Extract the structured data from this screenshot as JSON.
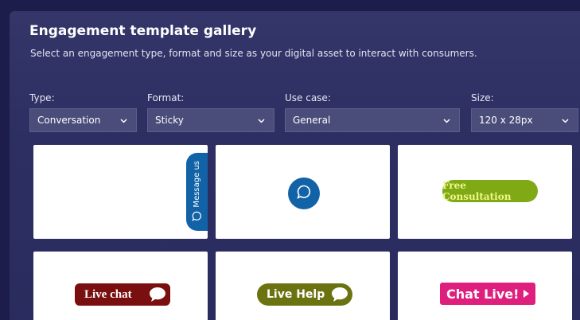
{
  "header": {
    "title": "Engagement template gallery",
    "subtitle": "Select an engagement type, format and size as your digital asset to interact with consumers."
  },
  "filters": {
    "type": {
      "label": "Type:",
      "value": "Conversation"
    },
    "format": {
      "label": "Format:",
      "value": "Sticky"
    },
    "use_case": {
      "label": "Use case:",
      "value": "General"
    },
    "size": {
      "label": "Size:",
      "value": "120 x 28px"
    }
  },
  "templates": [
    {
      "label": "Message us",
      "style": "vertical-side-tab",
      "color": "#1262a8",
      "icon": "chat-bubble-icon"
    },
    {
      "label": "",
      "style": "circle-icon-button",
      "color": "#1262a8",
      "icon": "chat-bubble-icon"
    },
    {
      "label": "Free Consultation",
      "style": "pill",
      "color": "#7faa16"
    },
    {
      "label": "Live chat",
      "style": "rounded",
      "color": "#7a0f0f",
      "icon": "speech-bubble-icon"
    },
    {
      "label": "Live Help",
      "style": "pill",
      "color": "#6b7310",
      "icon": "speech-bubble-icon"
    },
    {
      "label": "Chat Live!",
      "style": "rect",
      "color": "#df1f7d",
      "icon": "play-arrow-icon"
    }
  ],
  "colors": {
    "background": "#1c1d4a",
    "panel": "#2d2f63",
    "select_bg": "#4a4c7a"
  }
}
